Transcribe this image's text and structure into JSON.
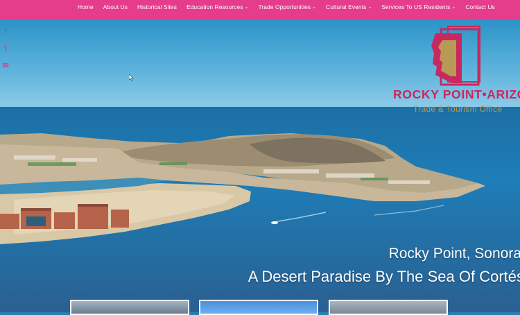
{
  "nav": {
    "items": [
      {
        "label": "Home",
        "has_dropdown": false
      },
      {
        "label": "About Us",
        "has_dropdown": false
      },
      {
        "label": "Historical Sites",
        "has_dropdown": false
      },
      {
        "label": "Education Resources",
        "has_dropdown": true
      },
      {
        "label": "Trade Opportunities",
        "has_dropdown": true
      },
      {
        "label": "Cultural Events",
        "has_dropdown": true
      },
      {
        "label": "Services To US Residents",
        "has_dropdown": true
      },
      {
        "label": "Contact Us",
        "has_dropdown": false
      }
    ],
    "chevron": "⌄"
  },
  "social": {
    "icons": [
      "facebook-icon",
      "twitter-icon",
      "email-icon"
    ],
    "glyphs": [
      "f",
      "t",
      "✉"
    ]
  },
  "logo": {
    "brand": "ROCKY POINT•ARIZONA",
    "tagline": "Trade & Tourism Office"
  },
  "hero": {
    "headline_1": "Rocky Point, Sonora",
    "headline_2": "A Desert Paradise By The Sea Of Cortés"
  },
  "colors": {
    "nav_bg": "#e63c8c",
    "brand": "#c8285f",
    "tagline": "#b79a55"
  }
}
